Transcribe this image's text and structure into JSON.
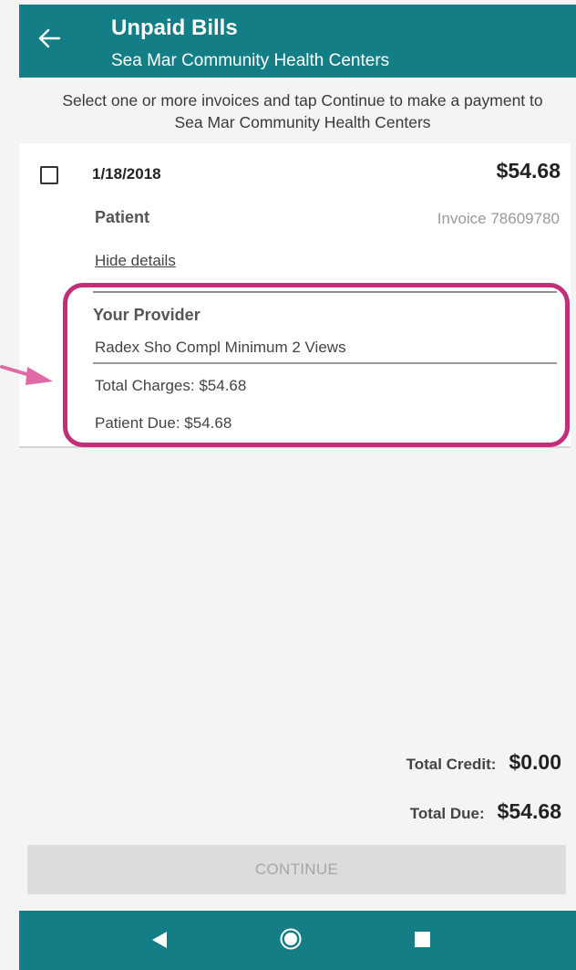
{
  "header": {
    "title": "Unpaid Bills",
    "subtitle": "Sea Mar Community Health Centers",
    "back_icon": "arrow-left-icon"
  },
  "instruction": "Select one or more invoices and tap Continue to make a payment to Sea Mar Community Health Centers",
  "invoice": {
    "date": "1/18/2018",
    "amount": "$54.68",
    "patient_label": "Patient",
    "invoice_number": "Invoice 78609780",
    "hide_details_label": "Hide details",
    "details": {
      "provider_heading": "Your Provider",
      "description": "Radex Sho Compl Minimum 2 Views",
      "total_charges": "Total Charges: $54.68",
      "patient_due": "Patient Due: $54.68"
    }
  },
  "totals": {
    "credit_label": "Total Credit:",
    "credit_value": "$0.00",
    "due_label": "Total Due:",
    "due_value": "$54.68"
  },
  "continue_label": "CONTINUE",
  "colors": {
    "header_bg": "#137e85",
    "highlight": "#c22f78",
    "arrow": "#e06aa5",
    "disabled_button": "#dcdcdc"
  },
  "nav": {
    "back_icon": "triangle-back-icon",
    "home_icon": "circle-home-icon",
    "recents_icon": "square-recents-icon"
  }
}
